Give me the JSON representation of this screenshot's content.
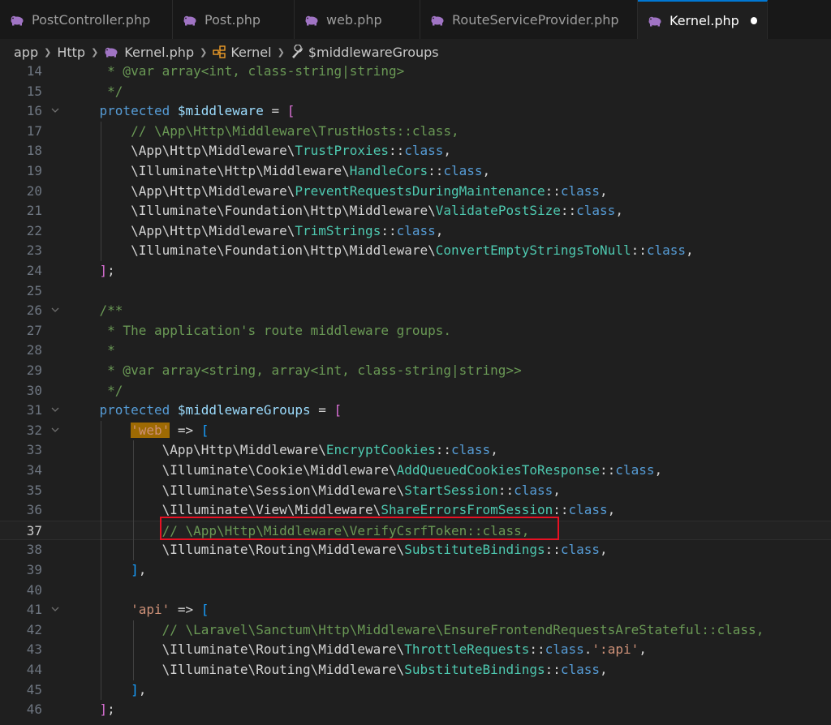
{
  "tabs": [
    {
      "label": "PostController.php",
      "active": false
    },
    {
      "label": "Post.php",
      "active": false
    },
    {
      "label": "web.php",
      "active": false
    },
    {
      "label": "RouteServiceProvider.php",
      "active": false
    },
    {
      "label": "Kernel.php",
      "active": true,
      "modified": true
    }
  ],
  "breadcrumb": [
    "app",
    "Http",
    "Kernel.php",
    "Kernel",
    "$middlewareGroups"
  ],
  "colors": {
    "php_icon": "#a074c4",
    "highlight_box": "#e81123",
    "active_tab_border": "#0078d4"
  },
  "current_line": 37,
  "lines": [
    {
      "num": "14",
      "fold": false,
      "tokens": [
        [
          "t-cm",
          "     * @var array<int, class-string|string>"
        ]
      ]
    },
    {
      "num": "15",
      "fold": false,
      "tokens": [
        [
          "t-cm",
          "     */"
        ]
      ]
    },
    {
      "num": "16",
      "fold": true,
      "tokens": [
        [
          "t-txt",
          "    "
        ],
        [
          "t-kw",
          "protected "
        ],
        [
          "t-var",
          "$middleware"
        ],
        [
          "t-op",
          " = "
        ],
        [
          "t-bk",
          "["
        ]
      ]
    },
    {
      "num": "17",
      "fold": false,
      "tokens": [
        [
          "t-txt",
          "        "
        ],
        [
          "t-cm",
          "// \\App\\Http\\Middleware\\TrustHosts::class,"
        ]
      ]
    },
    {
      "num": "18",
      "fold": false,
      "tokens": [
        [
          "t-txt",
          "        \\App\\Http\\Middleware\\"
        ],
        [
          "t-cls",
          "TrustProxies"
        ],
        [
          "t-op",
          "::"
        ],
        [
          "t-kw",
          "class"
        ],
        [
          "t-op",
          ","
        ]
      ]
    },
    {
      "num": "19",
      "fold": false,
      "tokens": [
        [
          "t-txt",
          "        \\Illuminate\\Http\\Middleware\\"
        ],
        [
          "t-cls",
          "HandleCors"
        ],
        [
          "t-op",
          "::"
        ],
        [
          "t-kw",
          "class"
        ],
        [
          "t-op",
          ","
        ]
      ]
    },
    {
      "num": "20",
      "fold": false,
      "tokens": [
        [
          "t-txt",
          "        \\App\\Http\\Middleware\\"
        ],
        [
          "t-cls",
          "PreventRequestsDuringMaintenance"
        ],
        [
          "t-op",
          "::"
        ],
        [
          "t-kw",
          "class"
        ],
        [
          "t-op",
          ","
        ]
      ]
    },
    {
      "num": "21",
      "fold": false,
      "tokens": [
        [
          "t-txt",
          "        \\Illuminate\\Foundation\\Http\\Middleware\\"
        ],
        [
          "t-cls",
          "ValidatePostSize"
        ],
        [
          "t-op",
          "::"
        ],
        [
          "t-kw",
          "class"
        ],
        [
          "t-op",
          ","
        ]
      ]
    },
    {
      "num": "22",
      "fold": false,
      "tokens": [
        [
          "t-txt",
          "        \\App\\Http\\Middleware\\"
        ],
        [
          "t-cls",
          "TrimStrings"
        ],
        [
          "t-op",
          "::"
        ],
        [
          "t-kw",
          "class"
        ],
        [
          "t-op",
          ","
        ]
      ]
    },
    {
      "num": "23",
      "fold": false,
      "tokens": [
        [
          "t-txt",
          "        \\Illuminate\\Foundation\\Http\\Middleware\\"
        ],
        [
          "t-cls",
          "ConvertEmptyStringsToNull"
        ],
        [
          "t-op",
          "::"
        ],
        [
          "t-kw",
          "class"
        ],
        [
          "t-op",
          ","
        ]
      ]
    },
    {
      "num": "24",
      "fold": false,
      "tokens": [
        [
          "t-txt",
          "    "
        ],
        [
          "t-bk",
          "]"
        ],
        [
          "t-op",
          ";"
        ]
      ]
    },
    {
      "num": "25",
      "fold": false,
      "tokens": []
    },
    {
      "num": "26",
      "fold": true,
      "tokens": [
        [
          "t-cm",
          "    /**"
        ]
      ]
    },
    {
      "num": "27",
      "fold": false,
      "tokens": [
        [
          "t-cm",
          "     * The application's route middleware groups."
        ]
      ]
    },
    {
      "num": "28",
      "fold": false,
      "tokens": [
        [
          "t-cm",
          "     *"
        ]
      ]
    },
    {
      "num": "29",
      "fold": false,
      "tokens": [
        [
          "t-cm",
          "     * @var array<string, array<int, class-string|string>>"
        ]
      ]
    },
    {
      "num": "30",
      "fold": false,
      "tokens": [
        [
          "t-cm",
          "     */"
        ]
      ]
    },
    {
      "num": "31",
      "fold": true,
      "tokens": [
        [
          "t-txt",
          "    "
        ],
        [
          "t-kw",
          "protected "
        ],
        [
          "t-var",
          "$middlewareGroups"
        ],
        [
          "t-op",
          " = "
        ],
        [
          "t-bk",
          "["
        ]
      ]
    },
    {
      "num": "32",
      "fold": true,
      "tokens": [
        [
          "t-txt",
          "        "
        ],
        [
          "t-hl",
          "'web'"
        ],
        [
          "t-op",
          " => "
        ],
        [
          "t-bk2",
          "["
        ]
      ]
    },
    {
      "num": "33",
      "fold": false,
      "tokens": [
        [
          "t-txt",
          "            \\App\\Http\\Middleware\\"
        ],
        [
          "t-cls",
          "EncryptCookies"
        ],
        [
          "t-op",
          "::"
        ],
        [
          "t-kw",
          "class"
        ],
        [
          "t-op",
          ","
        ]
      ]
    },
    {
      "num": "34",
      "fold": false,
      "tokens": [
        [
          "t-txt",
          "            \\Illuminate\\Cookie\\Middleware\\"
        ],
        [
          "t-cls",
          "AddQueuedCookiesToResponse"
        ],
        [
          "t-op",
          "::"
        ],
        [
          "t-kw",
          "class"
        ],
        [
          "t-op",
          ","
        ]
      ]
    },
    {
      "num": "35",
      "fold": false,
      "tokens": [
        [
          "t-txt",
          "            \\Illuminate\\Session\\Middleware\\"
        ],
        [
          "t-cls",
          "StartSession"
        ],
        [
          "t-op",
          "::"
        ],
        [
          "t-kw",
          "class"
        ],
        [
          "t-op",
          ","
        ]
      ]
    },
    {
      "num": "36",
      "fold": false,
      "tokens": [
        [
          "t-txt",
          "            \\Illuminate\\View\\Middleware\\"
        ],
        [
          "t-cls",
          "ShareErrorsFromSession"
        ],
        [
          "t-op",
          "::"
        ],
        [
          "t-kw",
          "class"
        ],
        [
          "t-op",
          ","
        ]
      ]
    },
    {
      "num": "37",
      "fold": false,
      "tokens": [
        [
          "t-txt",
          "            "
        ],
        [
          "t-cm",
          "// \\App\\Http\\Middleware\\VerifyCsrfToken::class,"
        ]
      ]
    },
    {
      "num": "38",
      "fold": false,
      "tokens": [
        [
          "t-txt",
          "            \\Illuminate\\Routing\\Middleware\\"
        ],
        [
          "t-cls",
          "SubstituteBindings"
        ],
        [
          "t-op",
          "::"
        ],
        [
          "t-kw",
          "class"
        ],
        [
          "t-op",
          ","
        ]
      ]
    },
    {
      "num": "39",
      "fold": false,
      "tokens": [
        [
          "t-txt",
          "        "
        ],
        [
          "t-bk2",
          "]"
        ],
        [
          "t-op",
          ","
        ]
      ]
    },
    {
      "num": "40",
      "fold": false,
      "tokens": []
    },
    {
      "num": "41",
      "fold": true,
      "tokens": [
        [
          "t-txt",
          "        "
        ],
        [
          "t-str",
          "'api'"
        ],
        [
          "t-op",
          " => "
        ],
        [
          "t-bk2",
          "["
        ]
      ]
    },
    {
      "num": "42",
      "fold": false,
      "tokens": [
        [
          "t-txt",
          "            "
        ],
        [
          "t-cm",
          "// \\Laravel\\Sanctum\\Http\\Middleware\\EnsureFrontendRequestsAreStateful::class,"
        ]
      ]
    },
    {
      "num": "43",
      "fold": false,
      "tokens": [
        [
          "t-txt",
          "            \\Illuminate\\Routing\\Middleware\\"
        ],
        [
          "t-cls",
          "ThrottleRequests"
        ],
        [
          "t-op",
          "::"
        ],
        [
          "t-kw",
          "class"
        ],
        [
          "t-op",
          "."
        ],
        [
          "t-str",
          "':api'"
        ],
        [
          "t-op",
          ","
        ]
      ]
    },
    {
      "num": "44",
      "fold": false,
      "tokens": [
        [
          "t-txt",
          "            \\Illuminate\\Routing\\Middleware\\"
        ],
        [
          "t-cls",
          "SubstituteBindings"
        ],
        [
          "t-op",
          "::"
        ],
        [
          "t-kw",
          "class"
        ],
        [
          "t-op",
          ","
        ]
      ]
    },
    {
      "num": "45",
      "fold": false,
      "tokens": [
        [
          "t-txt",
          "        "
        ],
        [
          "t-bk2",
          "]"
        ],
        [
          "t-op",
          ","
        ]
      ]
    },
    {
      "num": "46",
      "fold": false,
      "tokens": [
        [
          "t-txt",
          "    "
        ],
        [
          "t-bk",
          "]"
        ],
        [
          "t-op",
          ";"
        ]
      ]
    }
  ]
}
